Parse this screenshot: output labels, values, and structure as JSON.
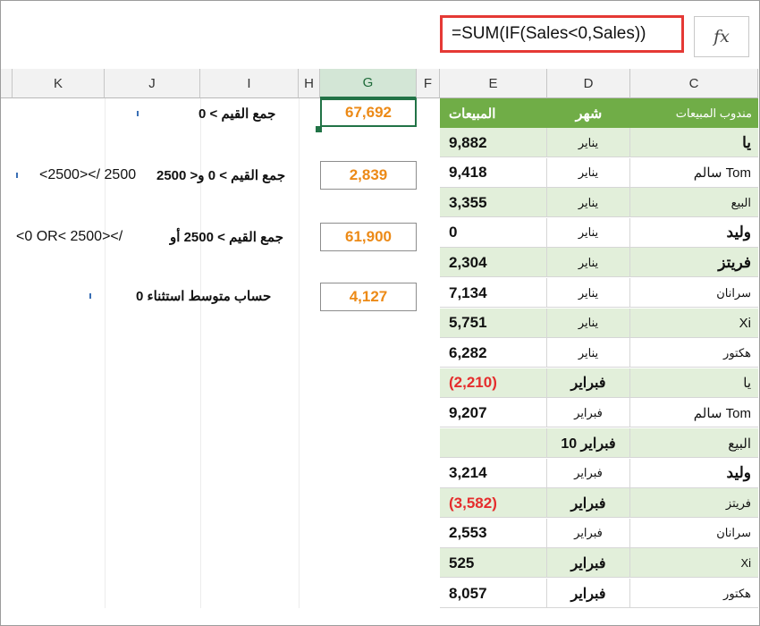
{
  "formula_bar": {
    "fx_icon": "function-icon",
    "formula": "=SUM(IF(Sales<0,Sales))"
  },
  "columns": [
    "K",
    "J",
    "I",
    "H",
    "G",
    "F",
    "E",
    "D",
    "C"
  ],
  "labels": {
    "sum_negative": "جمع القيم > 0",
    "sum_between": "جمع القيم > 0 و< 2500",
    "sum_or": "جمع القيم > 2500 أو",
    "average_excluding": "حساب متوسط استثناء 0"
  },
  "conditions": {
    "between": "<2500></ 2500",
    "or": "<0 OR< 2500></"
  },
  "results": {
    "sum_negative": "67,692",
    "sum_between": "2,839",
    "sum_or": "61,900",
    "average_excluding": "4,127"
  },
  "table": {
    "headers": {
      "rep": "مندوب المبيعات",
      "month": "شهر",
      "sales": "المبيعات"
    },
    "rows": [
      {
        "rep": "يا",
        "month": "يناير",
        "sales": "9,882"
      },
      {
        "rep": "سالم Tom",
        "month": "يناير",
        "sales": "9,418"
      },
      {
        "rep": "البيع",
        "month": "يناير",
        "sales": "3,355"
      },
      {
        "rep": "وليد",
        "month": "يناير",
        "sales": "0"
      },
      {
        "rep": "فريتز",
        "month": "يناير",
        "sales": "2,304"
      },
      {
        "rep": "سرانان",
        "month": "يناير",
        "sales": "7,134"
      },
      {
        "rep": "Xi",
        "month": "يناير",
        "sales": "5,751"
      },
      {
        "rep": "هكتور",
        "month": "يناير",
        "sales": "6,282"
      },
      {
        "rep": "يا",
        "month": "فبراير",
        "sales": "(2,210)"
      },
      {
        "rep": "سالم Tom",
        "month": "فبراير",
        "sales": "9,207"
      },
      {
        "rep": "البيع",
        "month": "فبراير 10",
        "sales": ""
      },
      {
        "rep": "وليد",
        "month": "فبراير",
        "sales": "3,214"
      },
      {
        "rep": "فريتز",
        "month": "فبراير",
        "sales": "(3,582)"
      },
      {
        "rep": "سرانان",
        "month": "فبراير",
        "sales": "2,553"
      },
      {
        "rep": "Xi",
        "month": "فبراير",
        "sales": "525"
      },
      {
        "rep": "هكتور",
        "month": "فبراير",
        "sales": "8,057"
      }
    ]
  },
  "colors": {
    "accent_green": "#70ad47",
    "negative_red": "#e52d2d",
    "result_orange": "#ec8a17",
    "formula_border": "#e53935"
  }
}
